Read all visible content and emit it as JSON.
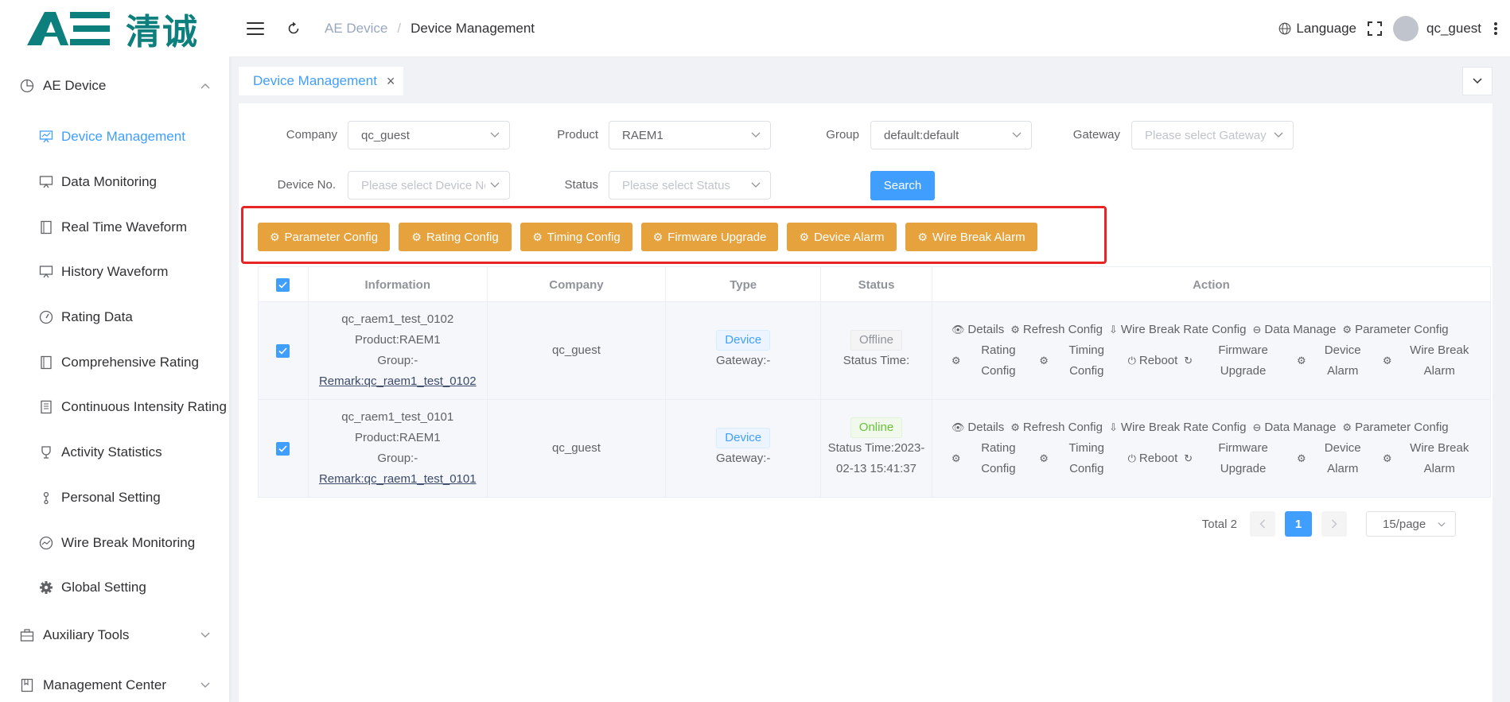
{
  "brand": {
    "logo_letters": "AE",
    "logo_text": "清诚"
  },
  "sidebar": {
    "groups": [
      {
        "label": "AE Device",
        "icon": "pie-chart-icon",
        "expanded": true
      },
      {
        "label": "Auxiliary Tools",
        "icon": "toolbox-icon",
        "expanded": false
      },
      {
        "label": "Management Center",
        "icon": "bookmark-icon",
        "expanded": false
      }
    ],
    "items": [
      {
        "label": "Device Management",
        "icon": "monitor-chart-icon",
        "active": true
      },
      {
        "label": "Data Monitoring",
        "icon": "monitor-icon"
      },
      {
        "label": "Real Time Waveform",
        "icon": "document-icon"
      },
      {
        "label": "History Waveform",
        "icon": "monitor-icon"
      },
      {
        "label": "Rating Data",
        "icon": "gauge-icon"
      },
      {
        "label": "Comprehensive Rating",
        "icon": "document-icon"
      },
      {
        "label": "Continuous Intensity Rating",
        "icon": "list-document-icon"
      },
      {
        "label": "Activity Statistics",
        "icon": "trophy-icon"
      },
      {
        "label": "Personal Setting",
        "icon": "user-icon"
      },
      {
        "label": "Wire Break Monitoring",
        "icon": "trend-icon"
      },
      {
        "label": "Global Setting",
        "icon": "gear-icon"
      }
    ]
  },
  "header": {
    "breadcrumb": [
      "AE Device",
      "Device Management"
    ],
    "language_label": "Language",
    "username": "qc_guest"
  },
  "tabs": [
    {
      "label": "Device Management",
      "active": true
    }
  ],
  "filters": {
    "company": {
      "label": "Company",
      "value": "qc_guest"
    },
    "product": {
      "label": "Product",
      "value": "RAEM1"
    },
    "group": {
      "label": "Group",
      "value": "default:default"
    },
    "gateway": {
      "label": "Gateway",
      "placeholder": "Please select Gateway"
    },
    "device_no": {
      "label": "Device No.",
      "placeholder": "Please select Device No"
    },
    "status": {
      "label": "Status",
      "placeholder": "Please select Status"
    },
    "search_label": "Search"
  },
  "action_buttons": [
    "Parameter Config",
    "Rating Config",
    "Timing Config",
    "Firmware Upgrade",
    "Device Alarm",
    "Wire Break Alarm"
  ],
  "table": {
    "columns": [
      "Information",
      "Company",
      "Type",
      "Status",
      "Action"
    ],
    "rows": [
      {
        "name": "qc_raem1_test_0102",
        "product": "Product:RAEM1",
        "group": "Group:-",
        "remark": "Remark:qc_raem1_test_0102",
        "company": "qc_guest",
        "type": "Device",
        "gateway": "Gateway:-",
        "status": "Offline",
        "status_time": "Status Time:",
        "status_time_2": ""
      },
      {
        "name": "qc_raem1_test_0101",
        "product": "Product:RAEM1",
        "group": "Group:-",
        "remark": "Remark:qc_raem1_test_0101",
        "company": "qc_guest",
        "type": "Device",
        "gateway": "Gateway:-",
        "status": "Online",
        "status_time": "Status Time:2023-",
        "status_time_2": "02-13 15:41:37"
      }
    ],
    "actions_line1": [
      "Details",
      "Refresh Config",
      "Wire Break Rate Config",
      "Data Manage",
      "Parameter Config"
    ],
    "actions_line2": [
      "Rating Config",
      "Timing Config",
      "Reboot",
      "Firmware Upgrade",
      "Device Alarm",
      "Wire Break Alarm"
    ]
  },
  "pagination": {
    "total_label": "Total 2",
    "current_page": "1",
    "page_size": "15/page"
  },
  "colors": {
    "primary": "#409eff",
    "warning": "#e6a23c",
    "highlight": "#e82525",
    "brand": "#0d7f7d"
  }
}
